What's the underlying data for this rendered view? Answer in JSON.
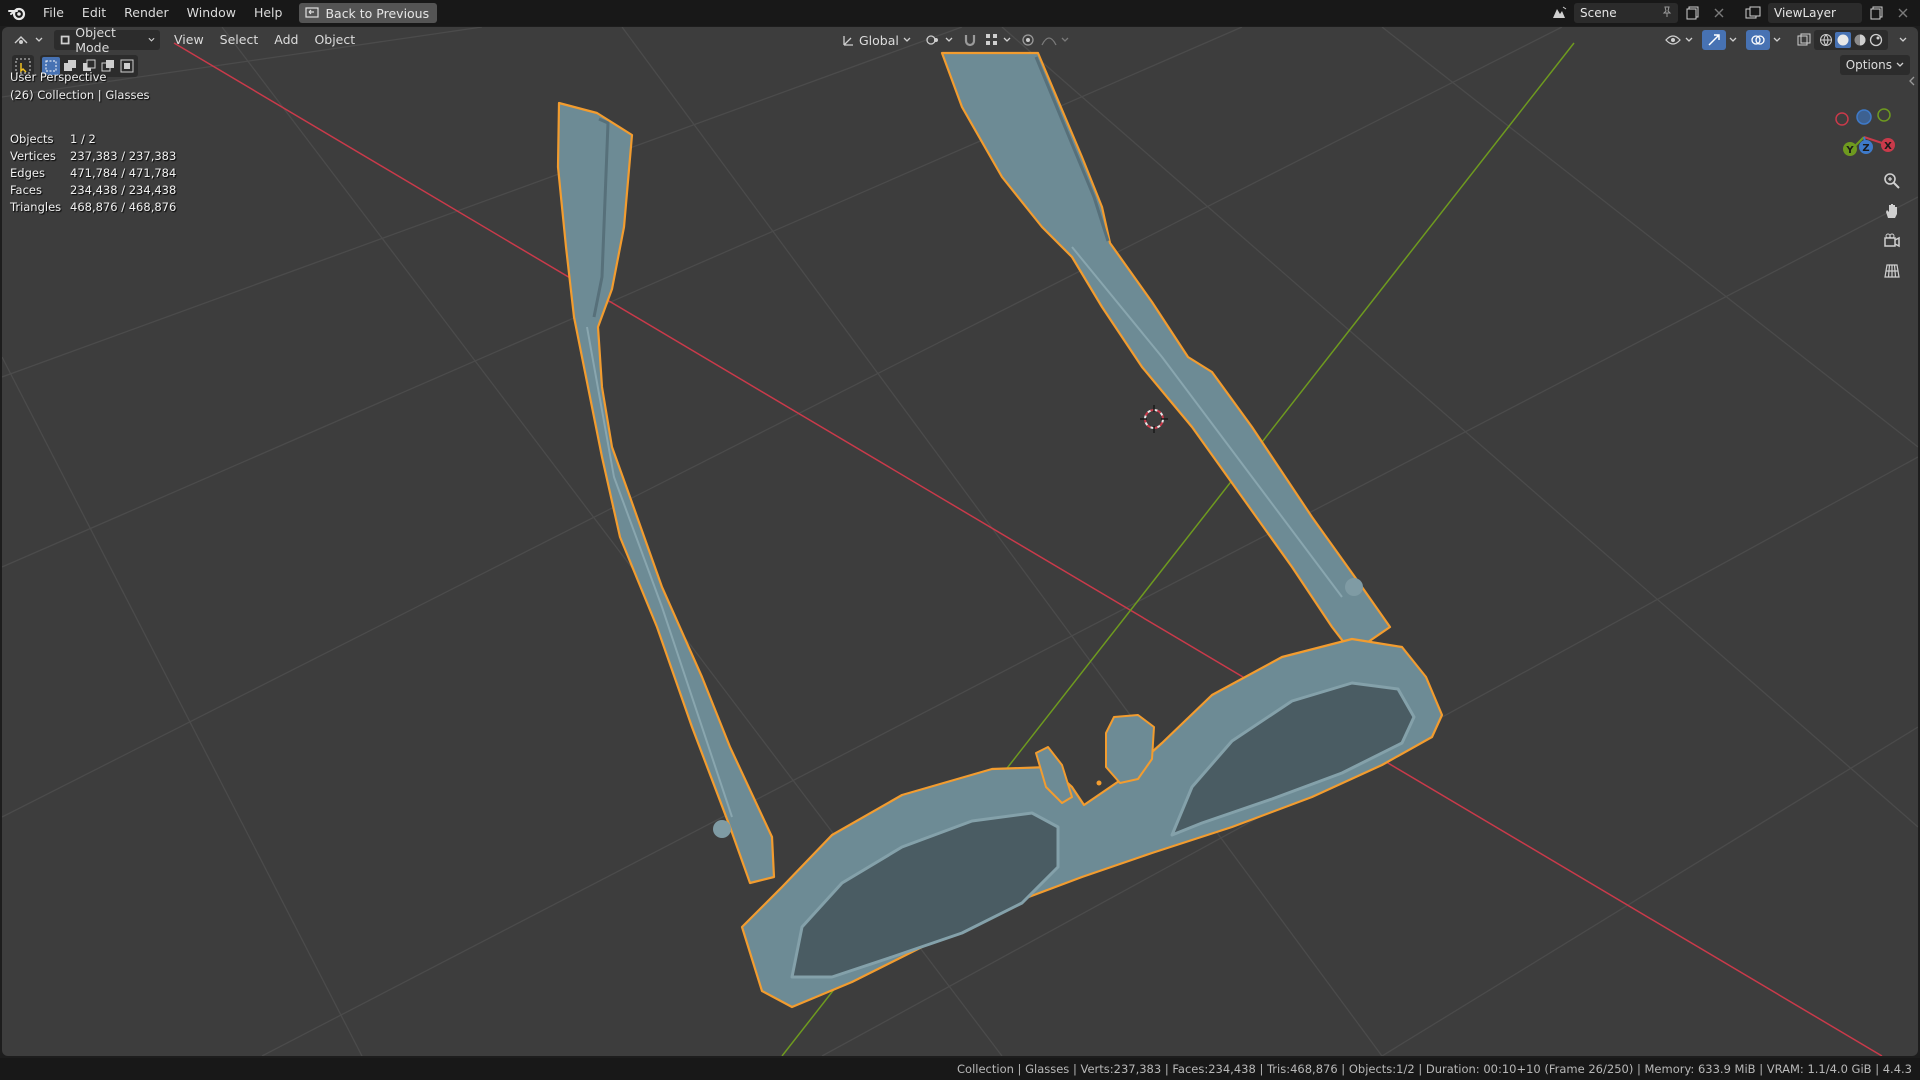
{
  "menu": {
    "items": [
      "File",
      "Edit",
      "Render",
      "Window",
      "Help"
    ],
    "back_label": "Back to Previous"
  },
  "scene": {
    "label": "Scene"
  },
  "view_layer": {
    "label": "ViewLayer"
  },
  "viewport_header": {
    "mode_label": "Object Mode",
    "menus": [
      "View",
      "Select",
      "Add",
      "Object"
    ],
    "orientation_label": "Global",
    "options_label": "Options"
  },
  "viewport_info": {
    "perspective": "User Perspective",
    "collection": "(26) Collection | Glasses"
  },
  "stats": [
    {
      "label": "Objects",
      "value": "1 / 2"
    },
    {
      "label": "Vertices",
      "value": "237,383 / 237,383"
    },
    {
      "label": "Edges",
      "value": "471,784 / 471,784"
    },
    {
      "label": "Faces",
      "value": "234,438 / 234,438"
    },
    {
      "label": "Triangles",
      "value": "468,876 / 468,876"
    }
  ],
  "gizmo": {
    "axes": [
      "X",
      "Y",
      "Z"
    ]
  },
  "status_bar": {
    "text": "Collection | Glasses | Verts:237,383 | Faces:234,438 | Tris:468,876 | Objects:1/2 | Duration: 00:10+10 (Frame 26/250) | Memory: 633.9 MiB | VRAM: 1.1/4.0 GiB | 4.4.3"
  },
  "colors": {
    "viewport_bg": "#3d3d3d",
    "x_axis": "#c93a4a",
    "y_axis": "#6e9a1f",
    "selection_outline": "#f29c2f",
    "model": "#6d8b95",
    "active_tool": "#4772b3"
  }
}
